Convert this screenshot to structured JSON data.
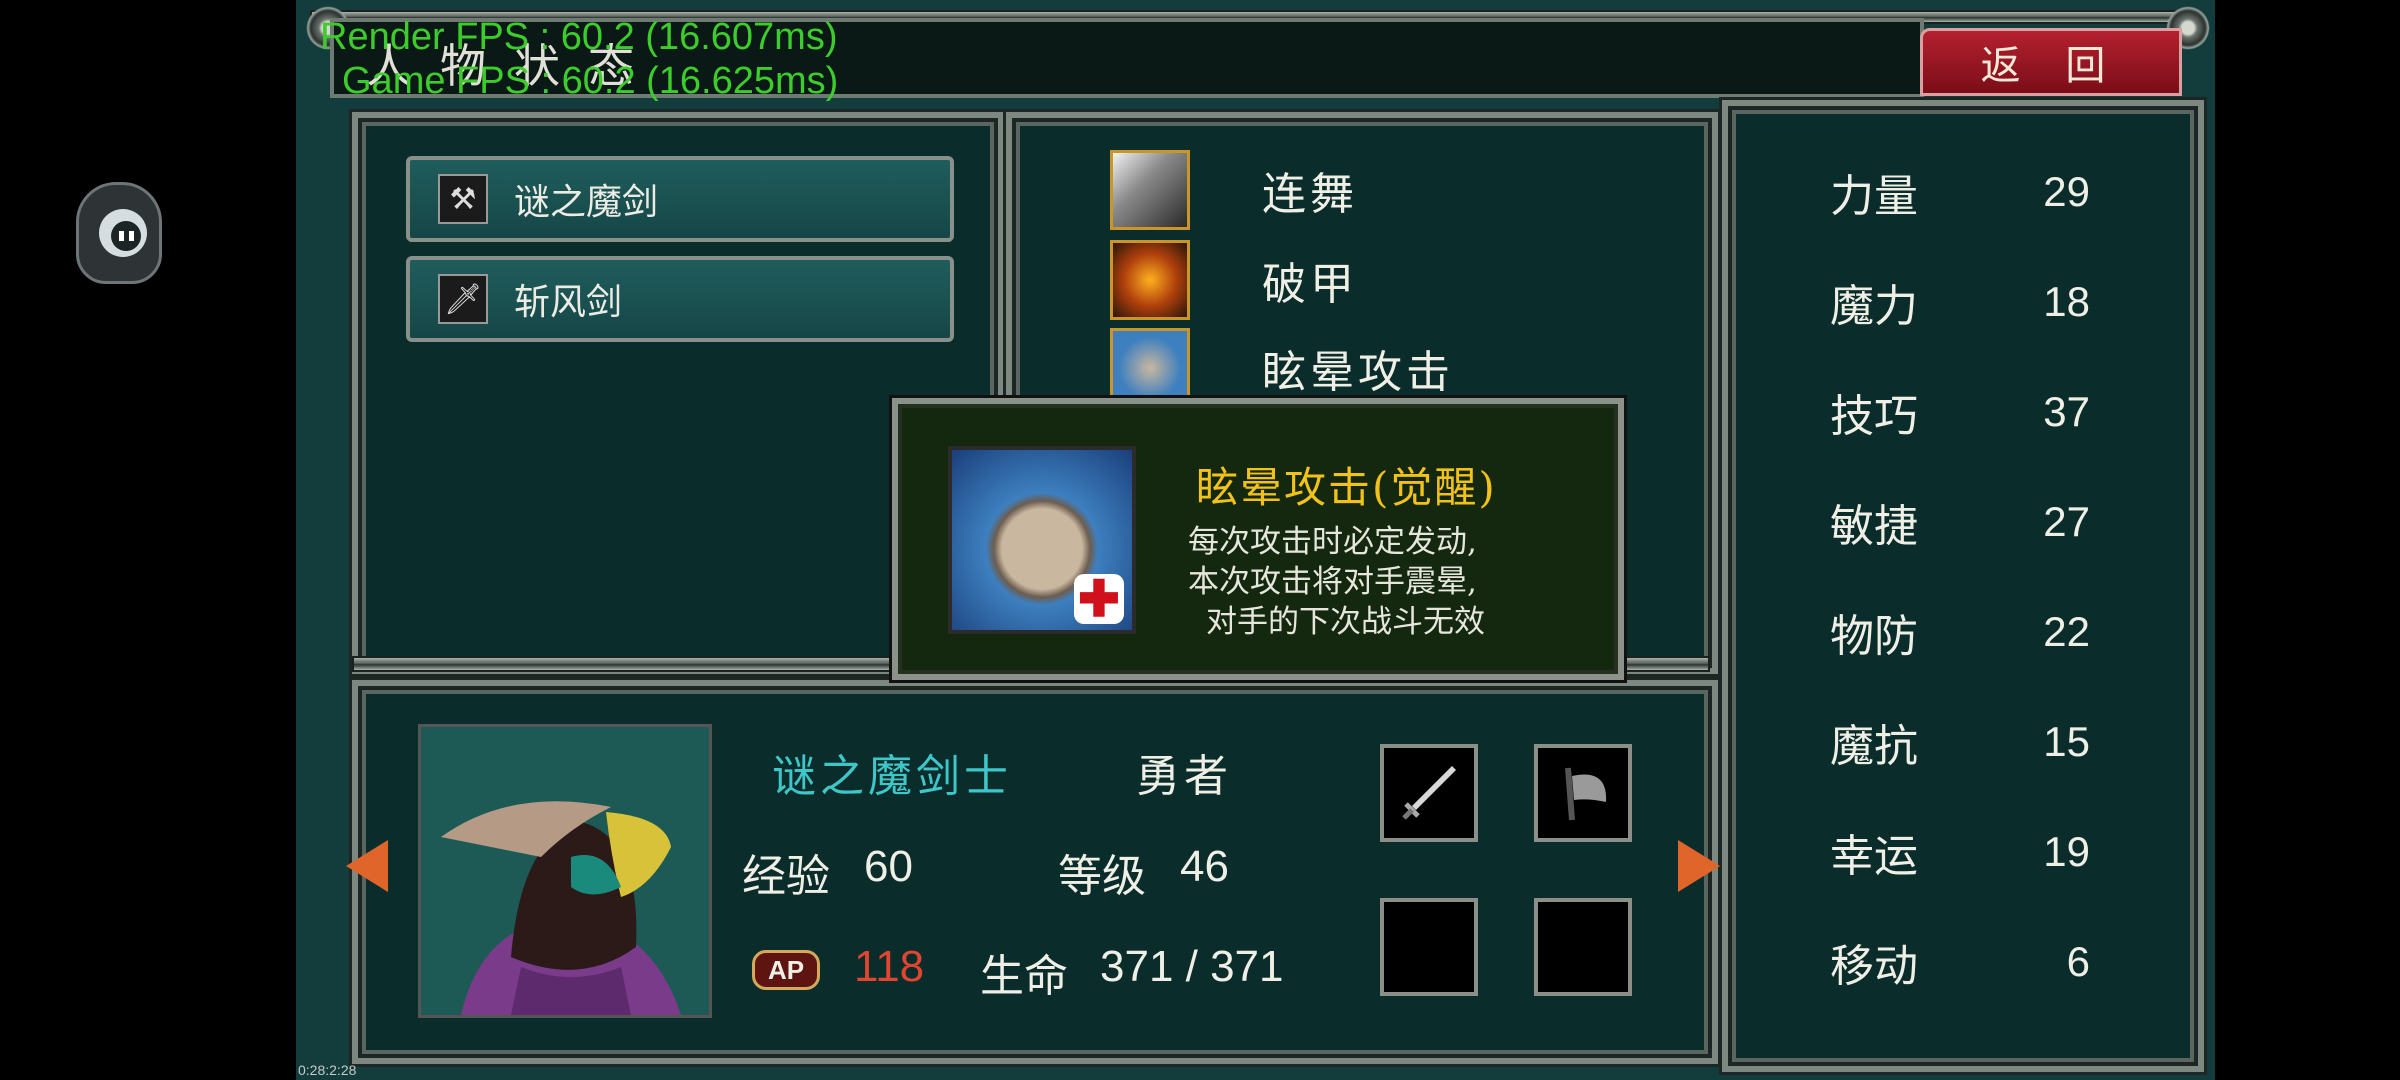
{
  "title": "人物状态",
  "back_label": "返 回",
  "debug": {
    "render_fps": "Render FPS : 60.2 (16.607ms)",
    "game_fps": "Game FPS : 60.2 (16.625ms)",
    "clock": "0:28:2:28"
  },
  "weapons": [
    {
      "label": "谜之魔剑",
      "icon": "sword-axe-icon"
    },
    {
      "label": "斩风剑",
      "icon": "sword-icon"
    }
  ],
  "skills": [
    {
      "name": "连舞",
      "icon": "slash-skill-icon"
    },
    {
      "name": "破甲",
      "icon": "armor-break-skill-icon"
    },
    {
      "name": "眩晕攻击",
      "icon": "stun-skill-icon"
    }
  ],
  "tooltip": {
    "title": "眩晕攻击(觉醒)",
    "desc_lines": [
      "每次攻击时必定发动,",
      "本次攻击将对手震晕,",
      "对手的下次战斗无效"
    ],
    "icon": "stun-skill-icon"
  },
  "character": {
    "name": "谜之魔剑士",
    "class": "勇者",
    "exp_label": "经验",
    "exp": "60",
    "level_label": "等级",
    "level": "46",
    "ap_badge": "AP",
    "ap": "118",
    "hp_label": "生命",
    "hp": "371 / 371"
  },
  "stats": [
    {
      "label": "力量",
      "value": "29"
    },
    {
      "label": "魔力",
      "value": "18"
    },
    {
      "label": "技巧",
      "value": "37"
    },
    {
      "label": "敏捷",
      "value": "27"
    },
    {
      "label": "物防",
      "value": "22"
    },
    {
      "label": "魔抗",
      "value": "15"
    },
    {
      "label": "幸运",
      "value": "19"
    },
    {
      "label": "移动",
      "value": "6"
    }
  ],
  "colors": {
    "name": "#3fc6c8",
    "ap_value": "#e0452f",
    "tooltip_title": "#f2c21b",
    "fps": "#3ccc2b",
    "back_button": "#a51827"
  }
}
